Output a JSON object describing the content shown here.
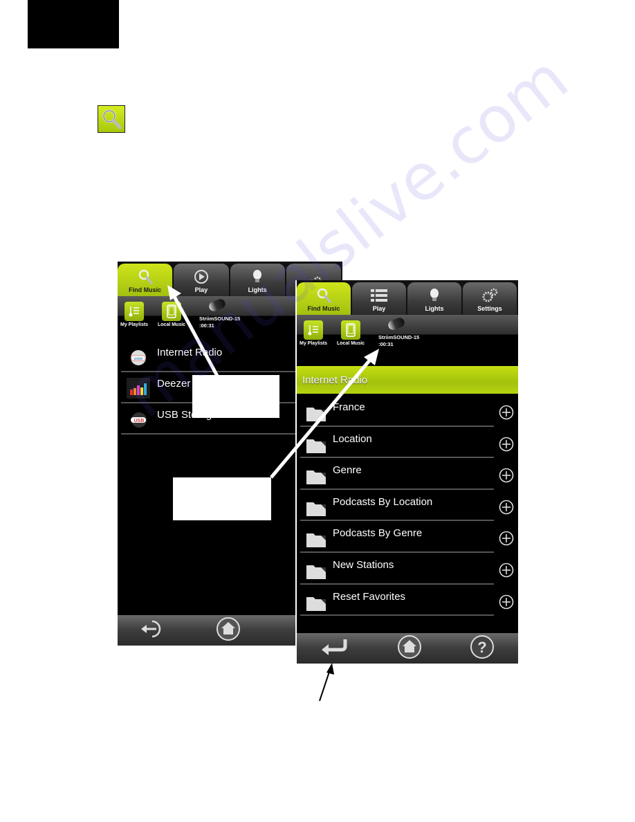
{
  "page": {
    "find_music_icon": "magnifier-icon",
    "watermark": "manualslive.com"
  },
  "colors": {
    "accent_green": "#b4d40f",
    "tab_gray": "#3b3b3b",
    "background": "#000000"
  },
  "left_screen": {
    "tabs": [
      {
        "label": "Find Music",
        "icon": "magnifier-icon",
        "active": true
      },
      {
        "label": "Play",
        "icon": "play-circle-icon",
        "active": false
      },
      {
        "label": "Lights",
        "icon": "lightbulb-icon",
        "active": false
      },
      {
        "label": "",
        "icon": "gears-icon",
        "active": false
      }
    ],
    "sources": [
      {
        "label": "My Playlists",
        "icon": "playlist-icon"
      },
      {
        "label": "Local Music",
        "icon": "phone-icon"
      }
    ],
    "speaker": {
      "name": "StriimSOUND-15",
      "time": ":00:31"
    },
    "menu": [
      {
        "label": "Internet Radio",
        "icon": "www-globe-icon"
      },
      {
        "label": "Deezer",
        "icon": "deezer-equalizer-icon"
      },
      {
        "label": "USB Storage",
        "icon": "usb-icon"
      }
    ],
    "bottom": [
      "back-icon",
      "home-icon"
    ]
  },
  "right_screen": {
    "tabs": [
      {
        "label": "Find Music",
        "icon": "magnifier-icon",
        "active": true
      },
      {
        "label": "Play",
        "icon": "list-icon",
        "active": false
      },
      {
        "label": "Lights",
        "icon": "lightbulb-icon",
        "active": false
      },
      {
        "label": "Settings",
        "icon": "gears-icon",
        "active": false
      }
    ],
    "sources": [
      {
        "label": "My Playlists",
        "icon": "playlist-icon"
      },
      {
        "label": "Local Music",
        "icon": "phone-icon"
      }
    ],
    "speaker": {
      "name": "StriimSOUND-15",
      "time": ":00:31"
    },
    "section_title": "Internet Radio",
    "folders": [
      {
        "label": "France"
      },
      {
        "label": "Location"
      },
      {
        "label": "Genre"
      },
      {
        "label": "Podcasts By Location"
      },
      {
        "label": "Podcasts By Genre"
      },
      {
        "label": "New Stations"
      },
      {
        "label": "Reset Favorites"
      }
    ],
    "bottom": [
      "return-icon",
      "home-icon",
      "help-icon"
    ]
  }
}
